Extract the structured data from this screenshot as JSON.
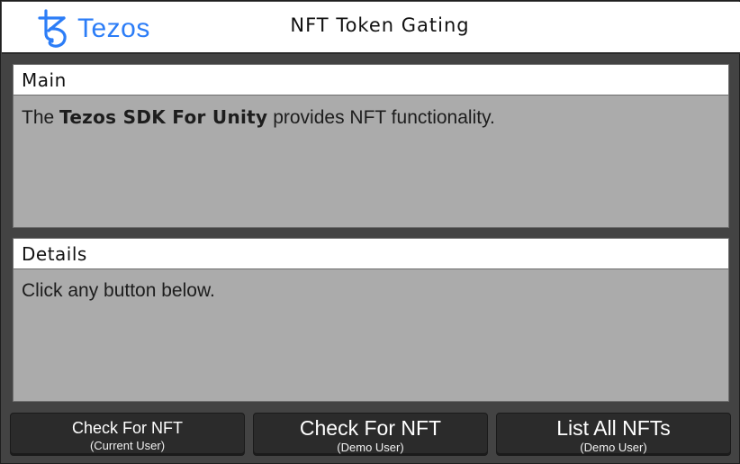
{
  "header": {
    "logo_text": "Tezos",
    "logo_icon": "tezos-logo-icon",
    "title": "NFT Token Gating"
  },
  "main_panel": {
    "title": "Main",
    "text_prefix": "The ",
    "text_bold": "Tezos SDK For Unity",
    "text_suffix": " provides NFT functionality."
  },
  "details_panel": {
    "title": "Details",
    "text": "Click any button below."
  },
  "buttons": [
    {
      "label": "Check For NFT",
      "sublabel": "(Current User)"
    },
    {
      "label": "Check For NFT",
      "sublabel": "(Demo User)"
    },
    {
      "label": "List All NFTs",
      "sublabel": "(Demo User)"
    }
  ],
  "colors": {
    "brand_blue": "#2c7df7",
    "background": "#434343",
    "panel_body": "#ababab",
    "button": "#2b2b2b"
  }
}
